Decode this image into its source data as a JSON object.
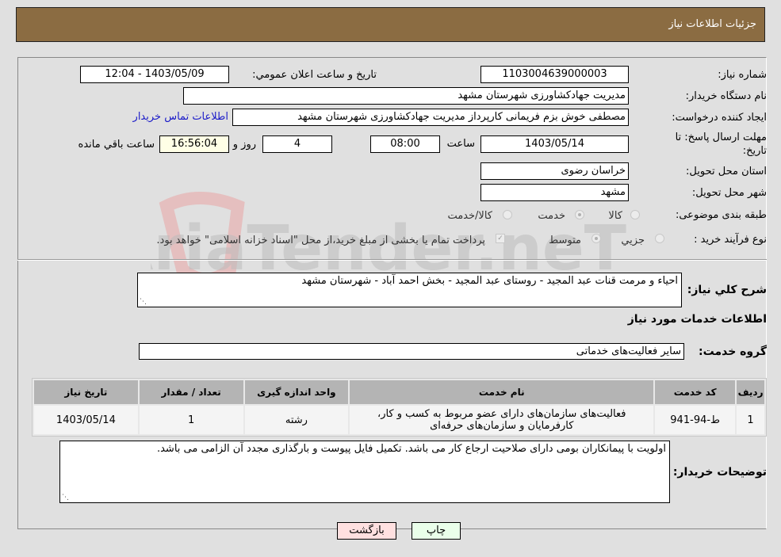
{
  "header": {
    "title": "جزئيات اطلاعات نياز"
  },
  "form": {
    "need_number": {
      "label": "شماره نياز:",
      "value": "1103004639000003"
    },
    "announce_datetime": {
      "label": "تاريخ و ساعت اعلان عمومي:",
      "value": "1403/05/09 - 12:04"
    },
    "buyer_org": {
      "label": "نام دستگاه خريدار:",
      "value": "مديريت جهادكشاورزی شهرستان مشهد"
    },
    "requester": {
      "label": "ايجاد كننده درخواست:",
      "value": "مصطفی خوش بزم فریمانی كارپرداز مديريت جهادكشاورزی شهرستان مشهد"
    },
    "buyer_contact_link": "اطلاعات تماس خريدار",
    "deadline": {
      "label_line1": "مهلت ارسال پاسخ: تا",
      "label_line2": "تاريخ:",
      "date": "1403/05/14",
      "time_label": "ساعت",
      "time": "08:00",
      "days": "4",
      "days_label": "روز و",
      "remaining": "16:56:04",
      "remaining_label": "ساعت باقي مانده"
    },
    "province": {
      "label": "استان محل تحويل:",
      "value": "خراسان رضوی"
    },
    "city": {
      "label": "شهر محل تحويل:",
      "value": "مشهد"
    },
    "category": {
      "label": "طبقه بندی موضوعی:",
      "options": [
        "كالا",
        "خدمت",
        "كالا/خدمت"
      ],
      "selected": "خدمت"
    },
    "purchase_type": {
      "label": "نوع فرآيند خريد :",
      "options": [
        "جزيي",
        "متوسط"
      ],
      "selected": "متوسط",
      "treasury_checkbox_checked": true,
      "treasury_note": "پرداخت تمام يا بخشی از مبلغ خريد،از محل \"اسناد خزانه اسلامی\" خواهد بود."
    }
  },
  "description": {
    "label": "شرح كلي نياز:",
    "value": "احیاء و مرمت قنات عبد المجید - روستای عبد المجید - بخش احمد آباد - شهرستان مشهد"
  },
  "services_section": {
    "title": "اطلاعات خدمات مورد نياز",
    "group_label": "گروه خدمت:",
    "group_value": "سایر فعالیت‌های خدماتی"
  },
  "table": {
    "headers": [
      "رديف",
      "كد خدمت",
      "نام خدمت",
      "واحد اندازه گيری",
      "تعداد / مقدار",
      "تاريخ نياز"
    ],
    "rows": [
      {
        "row": "1",
        "code": "ط-94-941",
        "name_line1": "فعالیت‌های سازمان‌های دارای عضو مربوط به کسب و کار،",
        "name_line2": "کارفرمایان و سازمان‌های حرفه‌ای",
        "unit": "رشته",
        "quantity": "1",
        "date": "1403/05/14"
      }
    ]
  },
  "buyer_notes": {
    "label": "توضيحات خريدار:",
    "value": "اولویت با پیمانکاران بومی دارای صلاحیت ارجاع کار می باشد. تکمیل فایل پیوست و بارگذاری مجدد آن الزامی می باشد."
  },
  "buttons": {
    "print": "چاپ",
    "back": "بازگشت"
  },
  "watermark": "AriaTender.neT",
  "colors": {
    "header": "#8b6c42",
    "print_bg": "#eaffea",
    "back_bg": "#ffe0e0",
    "link": "#1a1ac8"
  }
}
